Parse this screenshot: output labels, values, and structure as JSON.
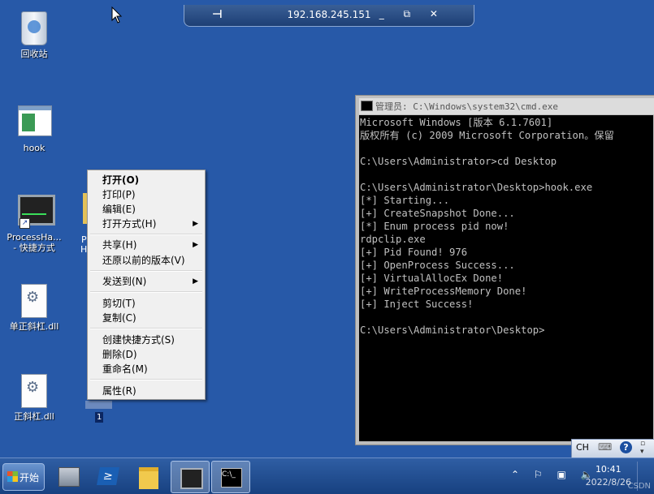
{
  "rdp": {
    "title": "192.168.245.151",
    "pin_icon": "pin-icon",
    "buttons": "_ ⧉ ✕"
  },
  "desktop": {
    "icons": [
      {
        "label": "回收站"
      },
      {
        "label": "hook"
      },
      {
        "label": "ProcessHa...\n- 快捷方式"
      },
      {
        "label": "单正斜杠.dll"
      },
      {
        "label": "正斜杠.dll"
      }
    ],
    "partial_label_1": "P",
    "partial_label_2": "H",
    "selected_label": "1"
  },
  "context_menu": {
    "items": [
      {
        "label": "打开(O)",
        "bold": true
      },
      {
        "label": "打印(P)"
      },
      {
        "label": "编辑(E)"
      },
      {
        "label": "打开方式(H)",
        "arrow": "▶"
      },
      {
        "label": "共享(H)",
        "arrow": "▶"
      },
      {
        "label": "还原以前的版本(V)"
      },
      {
        "label": "发送到(N)",
        "arrow": "▶"
      },
      {
        "label": "剪切(T)"
      },
      {
        "label": "复制(C)"
      },
      {
        "label": "创建快捷方式(S)"
      },
      {
        "label": "删除(D)"
      },
      {
        "label": "重命名(M)"
      },
      {
        "label": "属性(R)"
      }
    ]
  },
  "cmd": {
    "title": "管理员: C:\\Windows\\system32\\cmd.exe",
    "output": "Microsoft Windows [版本 6.1.7601]\n版权所有 (c) 2009 Microsoft Corporation。保留\n\nC:\\Users\\Administrator>cd Desktop\n\nC:\\Users\\Administrator\\Desktop>hook.exe\n[*] Starting...\n[+] CreateSnapshot Done...\n[*] Enum process pid now!\nrdpclip.exe\n[+] Pid Found! 976\n[+] OpenProcess Success...\n[+] VirtualAllocEx Done!\n[+] WriteProcessMemory Done!\n[+] Inject Success!\n\nC:\\Users\\Administrator\\Desktop>"
  },
  "langbar": {
    "lang": "CH",
    "keyboard_icon": "keyboard-icon",
    "help": "?",
    "options_icon": "options-icon"
  },
  "taskbar": {
    "start_label": "开始",
    "buttons": [
      "server-manager",
      "powershell",
      "explorer",
      "process-hacker",
      "cmd"
    ],
    "tray_icons": "⌃ ⚐ ▣ 🔈",
    "time": "10:41",
    "date": "2022/8/26"
  },
  "watermark": "CSDN"
}
